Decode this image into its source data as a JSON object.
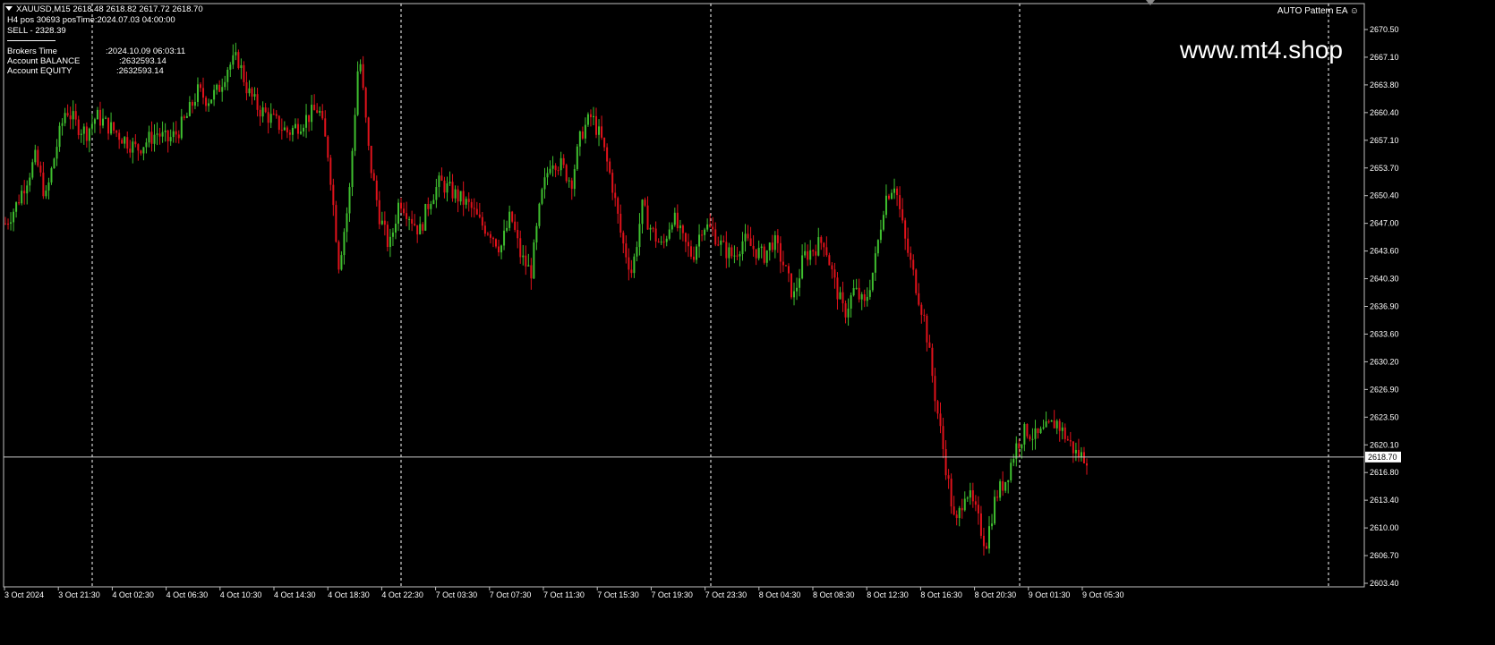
{
  "chart_data": {
    "type": "candlestick",
    "symbol_line": "XAUUSD,M15  2618.48 2618.82 2617.72 2618.70",
    "current_price": 2618.7,
    "ylim": [
      2603.4,
      2672.0
    ],
    "y_ticks": [
      "2670.50",
      "2667.10",
      "2663.80",
      "2660.40",
      "2657.10",
      "2653.70",
      "2650.40",
      "2647.00",
      "2643.60",
      "2640.30",
      "2636.90",
      "2633.60",
      "2630.20",
      "2626.90",
      "2623.50",
      "2620.10",
      "2616.80",
      "2613.40",
      "2610.00",
      "2606.70",
      "2603.40"
    ],
    "x_ticks": [
      "3 Oct 2024",
      "3 Oct 21:30",
      "4 Oct 02:30",
      "4 Oct 06:30",
      "4 Oct 10:30",
      "4 Oct 14:30",
      "4 Oct 18:30",
      "4 Oct 22:30",
      "7 Oct 03:30",
      "7 Oct 07:30",
      "7 Oct 11:30",
      "7 Oct 15:30",
      "7 Oct 19:30",
      "7 Oct 23:30",
      "8 Oct 04:30",
      "8 Oct 08:30",
      "8 Oct 12:30",
      "8 Oct 16:30",
      "8 Oct 20:30",
      "9 Oct 01:30",
      "9 Oct 05:30"
    ],
    "close_path": [
      2647,
      2649,
      2652,
      2655,
      2650,
      2656,
      2661,
      2659,
      2658,
      2660,
      2659,
      2658,
      2657,
      2656,
      2657,
      2658,
      2657,
      2658,
      2660,
      2663,
      2662,
      2663,
      2666,
      2667,
      2663,
      2661,
      2660,
      2659,
      2658,
      2659,
      2660,
      2661,
      2655,
      2642,
      2650,
      2668,
      2655,
      2648,
      2644,
      2650,
      2648,
      2646,
      2650,
      2652,
      2651,
      2650,
      2649,
      2647,
      2646,
      2644,
      2648,
      2643,
      2641,
      2650,
      2655,
      2654,
      2652,
      2658,
      2660,
      2657,
      2652,
      2645,
      2641,
      2649,
      2646,
      2644,
      2648,
      2645,
      2643,
      2647,
      2646,
      2644,
      2643,
      2645,
      2644,
      2643,
      2645,
      2642,
      2638,
      2643,
      2644,
      2645,
      2640,
      2636,
      2639,
      2637,
      2642,
      2650,
      2652,
      2645,
      2640,
      2635,
      2626,
      2618,
      2610,
      2615,
      2612,
      2608,
      2614,
      2616,
      2620,
      2622,
      2621,
      2622,
      2623,
      2621,
      2619,
      2618.7
    ],
    "dashed_vlines_x": [
      103,
      448,
      794,
      1139,
      1484
    ]
  },
  "info_panel": {
    "line1": "XAUUSD,M15  2618.48 2618.82 2617.72 2618.70",
    "line2": "H4 pos 30693 posTime:2024.07.03 04:00:00",
    "line3": "SELL - 2328.39",
    "brokers_time_label": "Brokers Time",
    "brokers_time_value": ":2024.10.09 06:03:11",
    "balance_label": "Account BALANCE",
    "balance_value": ":2632593.14",
    "equity_label": "Account EQUITY",
    "equity_value": ":2632593.14"
  },
  "ea_label": "AUTO Pattern EA ☺",
  "watermark": "www.mt4.shop",
  "colors": {
    "bull": "#3fbf2f",
    "bear": "#e0121b",
    "grid": "#ffffff",
    "axis": "#c0c0c0",
    "bg": "#000000"
  }
}
